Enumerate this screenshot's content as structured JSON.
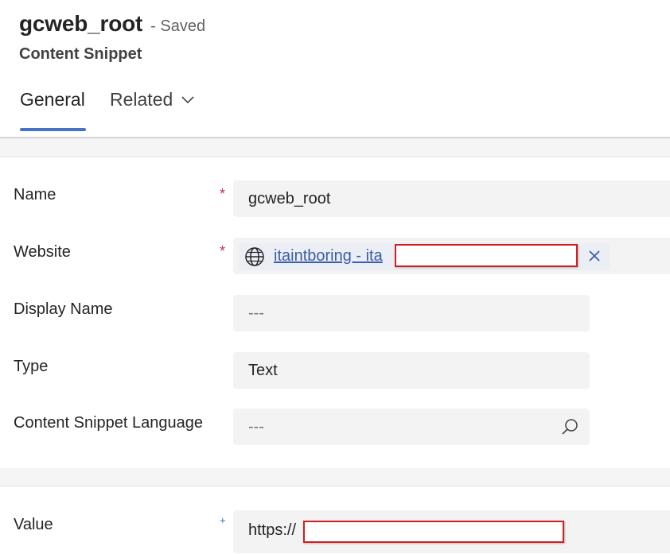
{
  "record": {
    "title": "gcweb_root",
    "status": "- Saved",
    "entity_type": "Content Snippet"
  },
  "tabs": [
    {
      "label": "General",
      "selected": true
    },
    {
      "label": "Related",
      "has_dropdown": true
    }
  ],
  "form": {
    "name": {
      "label": "Name",
      "required_marker": "*",
      "value": "gcweb_root"
    },
    "website": {
      "label": "Website",
      "required_marker": "*",
      "value": "itaintboring - ita",
      "icon": "globe-icon",
      "clear_icon": "close-icon"
    },
    "display_name": {
      "label": "Display Name",
      "value": "---"
    },
    "type": {
      "label": "Type",
      "value": "Text"
    },
    "language": {
      "label": "Content Snippet Language",
      "value": "---",
      "icon": "search-icon"
    },
    "value": {
      "label": "Value",
      "recommended_marker": "+",
      "value": "https://"
    }
  },
  "colors": {
    "accent": "#4472c4",
    "link": "#3b5ea8",
    "required": "#c4314b",
    "redaction": "#d01f1f"
  }
}
